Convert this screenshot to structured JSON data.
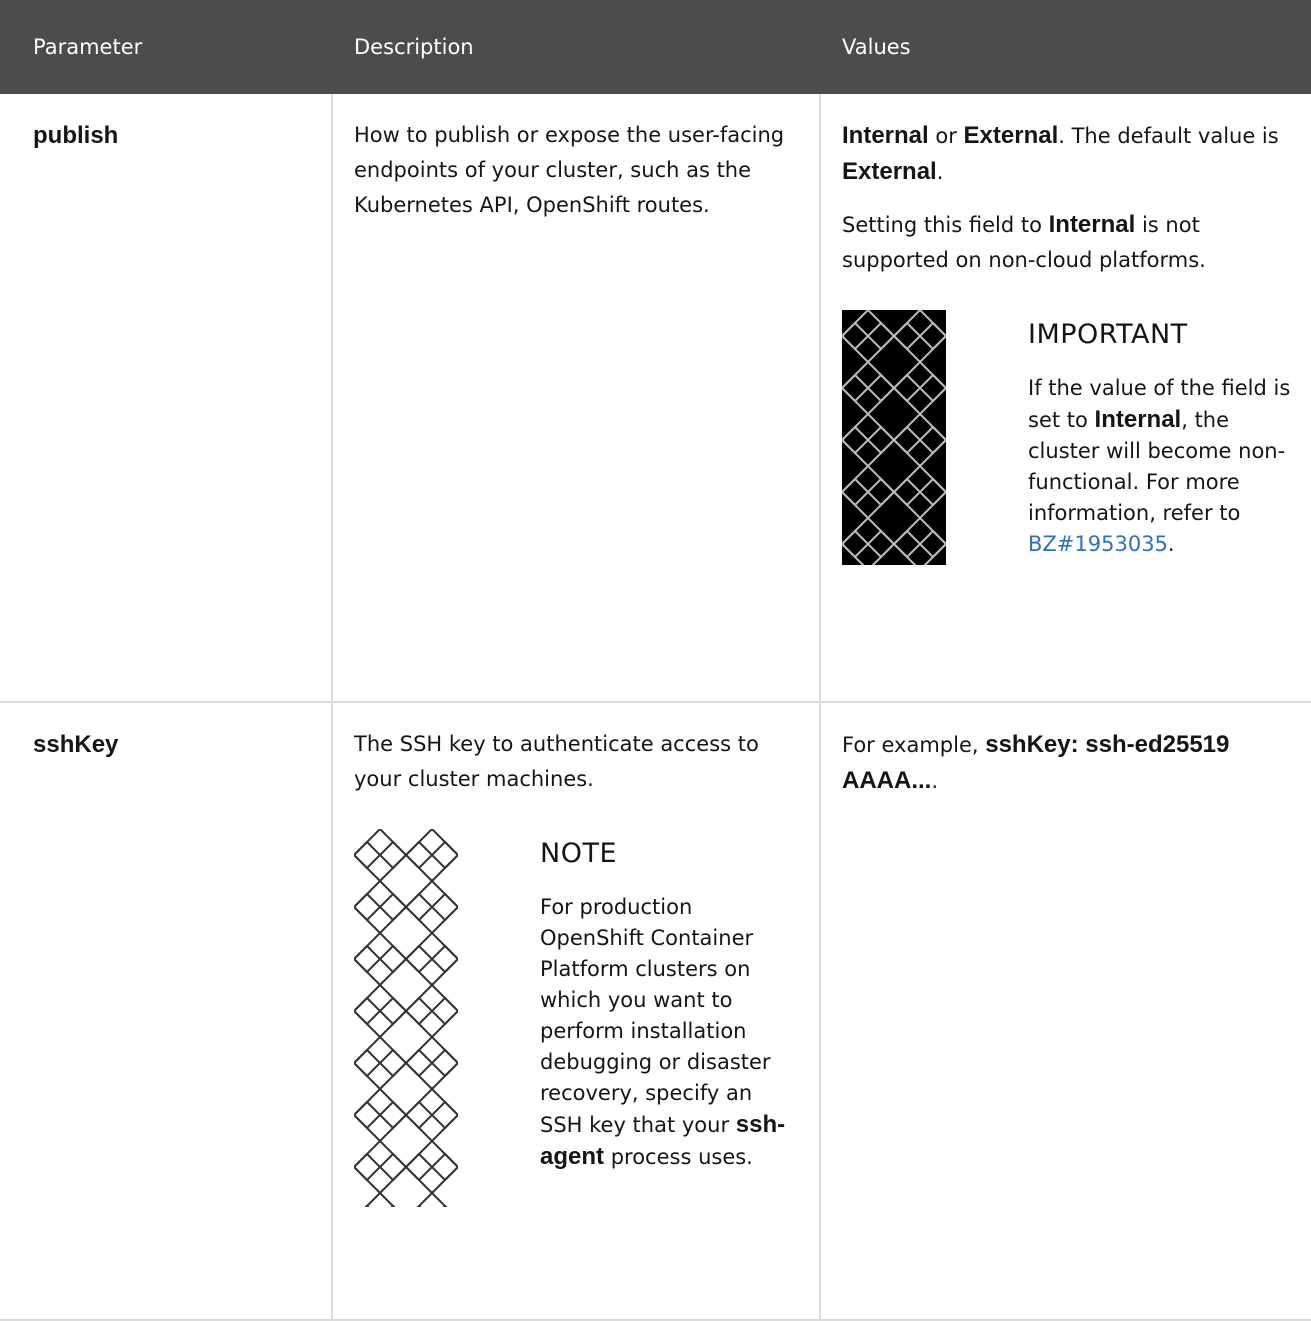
{
  "header": {
    "parameter": "Parameter",
    "description": "Description",
    "values": "Values"
  },
  "rows": [
    {
      "parameter": "publish",
      "description": "How to publish or expose the user-facing endpoints of your cluster, such as the Kubernetes API, OpenShift routes.",
      "values": {
        "internal": "Internal",
        "or": " or ",
        "external": "External",
        "default_text": ". The default value is ",
        "default_value": "External",
        "period": ".",
        "note_prefix": "Setting this field to ",
        "note_value": "Internal",
        "note_suffix": " is not supported on non-cloud platforms."
      },
      "admonition": {
        "icon": "important-pattern-icon",
        "title": "IMPORTANT",
        "text_prefix": "If the value of the field is set to ",
        "text_value": "Internal",
        "text_middle": ", the cluster will become non-functional. For more information, refer to ",
        "link": "BZ#1953035",
        "text_suffix": "."
      }
    },
    {
      "parameter": "sshKey",
      "description": "The SSH key to authenticate access to your cluster machines.",
      "admonition": {
        "icon": "note-pattern-icon",
        "title": "NOTE",
        "text_prefix": "For production OpenShift Container Platform clusters on which you want to perform installation debugging or disaster recovery, specify an SSH key that your ",
        "text_value": "ssh-agent",
        "text_suffix": " process uses."
      },
      "values": {
        "prefix": "For example, ",
        "example": "sshKey: ssh-ed25519 AAAA...",
        "suffix": "."
      }
    }
  ],
  "colors": {
    "header_bg": "#4c4c4c",
    "link": "#2e70c4",
    "border": "#dcdcdc"
  }
}
